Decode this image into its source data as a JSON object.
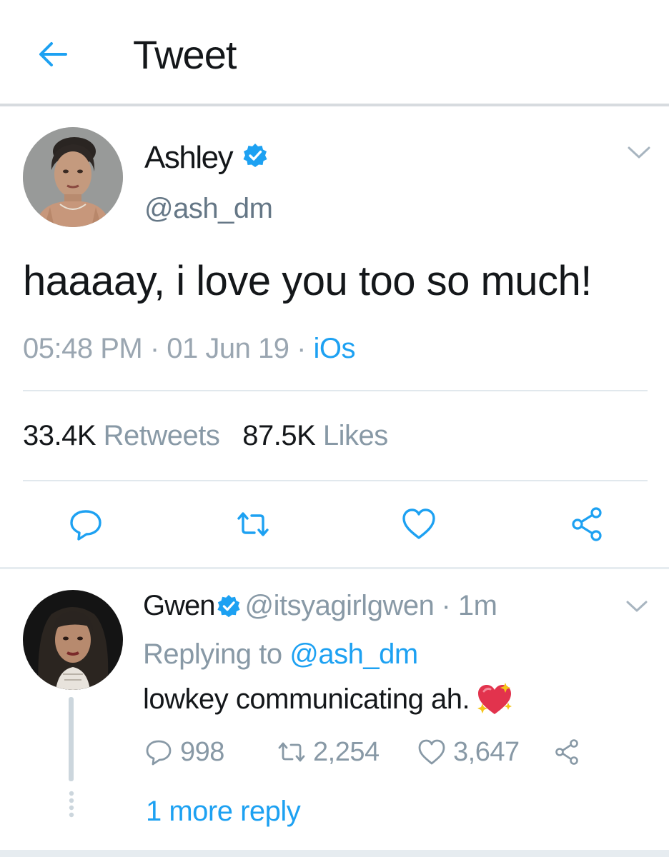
{
  "header": {
    "title": "Tweet",
    "back_icon": "arrow-left-icon"
  },
  "tweet": {
    "name": "Ashley",
    "handle": "@ash_dm",
    "text": "haaaay, i love you too so much!",
    "time": "05:48 PM",
    "date": "01 Jun 19",
    "source": "iOs",
    "separator": " · ",
    "retweets_count": "33.4K",
    "retweets_label": "Retweets",
    "likes_count": "87.5K",
    "likes_label": "Likes",
    "actions": [
      "reply-icon",
      "retweet-icon",
      "heart-icon",
      "share-icon"
    ]
  },
  "reply": {
    "name": "Gwen",
    "handle": "@itsyagirlgwen",
    "age": "· 1m",
    "replying_prefix": "Replying to",
    "replying_to": "@ash_dm",
    "text": "lowkey communicating ah.",
    "emoji": "sparkling-heart-emoji",
    "reply_count": "998",
    "retweet_count": "2,254",
    "like_count": "3,647",
    "more_replies": "1 more reply"
  },
  "colors": {
    "accent": "#1da1f2",
    "secondary_text": "#8899a6",
    "divider": "#e1e8ed",
    "primary_text": "#14171a"
  }
}
